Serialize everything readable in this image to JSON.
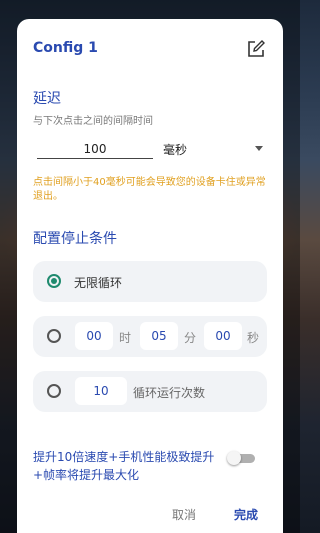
{
  "dialog": {
    "title": "Config 1",
    "icons": {
      "edit": "edit-icon"
    }
  },
  "delay": {
    "title": "延迟",
    "hint": "与下次点击之间的间隔时间",
    "value": "100",
    "unit": "毫秒",
    "warning": "点击间隔小于40毫秒可能会导致您的设备卡住或异常退出。"
  },
  "stop": {
    "title": "配置停止条件",
    "infinite_label": "无限循环",
    "timer": {
      "hours": "00",
      "hours_label": "时",
      "minutes": "05",
      "minutes_label": "分",
      "seconds": "00",
      "seconds_label": "秒"
    },
    "count": {
      "value": "10",
      "label": "循环运行次数"
    },
    "selected": "infinite"
  },
  "boost": {
    "text": "提升10倍速度+手机性能极致提升+帧率将提升最大化",
    "enabled": false
  },
  "actions": {
    "cancel": "取消",
    "done": "完成"
  },
  "colors": {
    "accent": "#2a4ab0",
    "radio_active": "#1f8a6e",
    "warning": "#e0a020"
  }
}
